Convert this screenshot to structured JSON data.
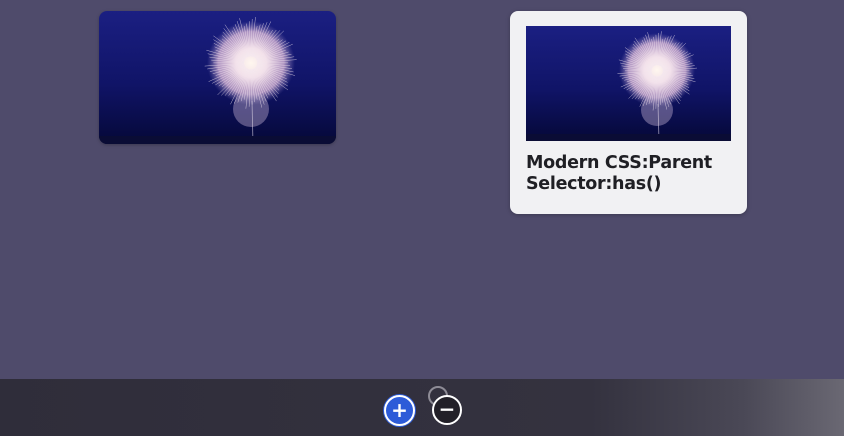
{
  "cards": [
    {
      "variant": "image-only",
      "image": "fireworks-night-sky"
    },
    {
      "variant": "image-with-title",
      "image": "fireworks-night-sky",
      "title": "Modern CSS:Parent Selector:has()"
    }
  ],
  "controls": {
    "add_glyph": "+",
    "remove_glyph": "−",
    "add_color": "#2d5bd8",
    "remove_color": "#222028"
  },
  "colors": {
    "background": "#4f4b6b",
    "card_background": "#f1f1f3",
    "bottom_bar": "#302e3b"
  }
}
